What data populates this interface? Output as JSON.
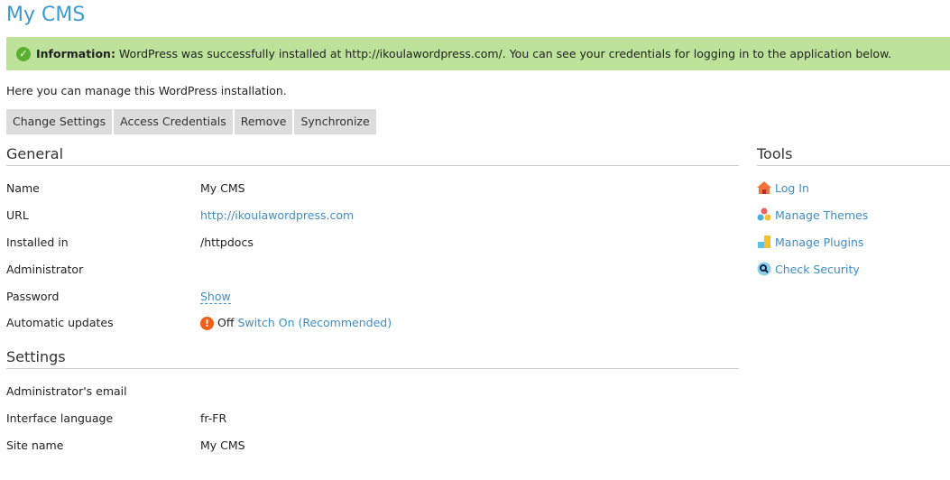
{
  "title": "My CMS",
  "info": {
    "label": "Information:",
    "text": " WordPress was successfully installed at http://ikoulawordpress.com/. You can see your credentials for logging in to the application below."
  },
  "intro": "Here you can manage this WordPress installation.",
  "tabs": [
    "Change Settings",
    "Access Credentials",
    "Remove",
    "Synchronize"
  ],
  "general": {
    "title": "General",
    "rows": [
      {
        "k": "Name",
        "v": "My CMS"
      },
      {
        "k": "URL",
        "v": "http://ikoulawordpress.com"
      },
      {
        "k": "Installed in",
        "v": "/httpdocs"
      },
      {
        "k": "Administrator",
        "v": ""
      },
      {
        "k": "Password",
        "v": "Show"
      },
      {
        "k": "Automatic updates",
        "v": "Off",
        "link": "Switch On (Recommended)"
      }
    ]
  },
  "settings": {
    "title": "Settings",
    "rows": [
      {
        "k": "Administrator's email",
        "v": ""
      },
      {
        "k": "Interface language",
        "v": "fr-FR"
      },
      {
        "k": "Site name",
        "v": "My CMS"
      }
    ]
  },
  "tools": {
    "title": "Tools",
    "items": [
      "Log In",
      "Manage Themes",
      "Manage Plugins",
      "Check Security"
    ]
  }
}
